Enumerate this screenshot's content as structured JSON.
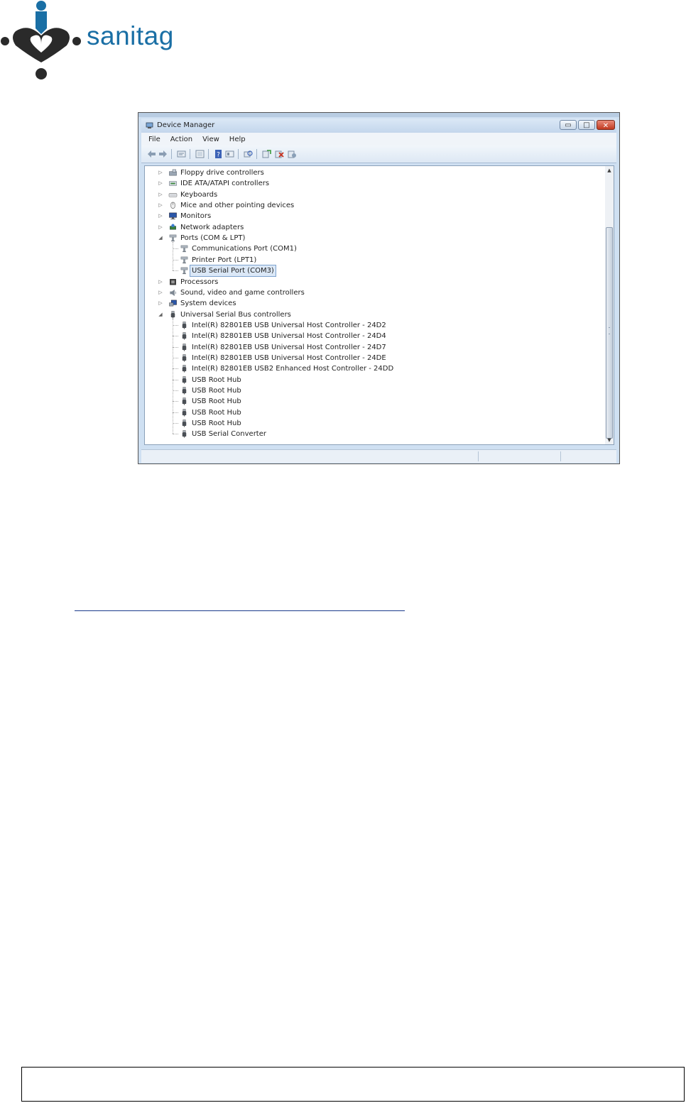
{
  "brand": {
    "name": "sanitag",
    "color": "#1a6fa5"
  },
  "window": {
    "title": "Device Manager",
    "menu": [
      "File",
      "Action",
      "View",
      "Help"
    ],
    "controls": {
      "minimize": "▭",
      "maximize": "□",
      "close": "✕"
    }
  },
  "tree": {
    "items": [
      {
        "label": "Floppy drive controllers",
        "level": 0,
        "expander": "▷",
        "icon": "floppy-controller-icon"
      },
      {
        "label": "IDE ATA/ATAPI controllers",
        "level": 0,
        "expander": "▷",
        "icon": "ide-controller-icon"
      },
      {
        "label": "Keyboards",
        "level": 0,
        "expander": "▷",
        "icon": "keyboard-icon"
      },
      {
        "label": "Mice and other pointing devices",
        "level": 0,
        "expander": "▷",
        "icon": "mouse-icon"
      },
      {
        "label": "Monitors",
        "level": 0,
        "expander": "▷",
        "icon": "monitor-icon"
      },
      {
        "label": "Network adapters",
        "level": 0,
        "expander": "▷",
        "icon": "network-adapter-icon"
      },
      {
        "label": "Ports (COM & LPT)",
        "level": 0,
        "expander": "◢",
        "icon": "port-icon"
      },
      {
        "label": "Communications Port (COM1)",
        "level": 1,
        "icon": "port-icon"
      },
      {
        "label": "Printer Port (LPT1)",
        "level": 1,
        "icon": "port-icon"
      },
      {
        "label": "USB Serial Port (COM3)",
        "level": 1,
        "icon": "port-icon",
        "selected": true
      },
      {
        "label": "Processors",
        "level": 0,
        "expander": "▷",
        "icon": "processor-icon"
      },
      {
        "label": "Sound, video and game controllers",
        "level": 0,
        "expander": "▷",
        "icon": "sound-icon"
      },
      {
        "label": "System devices",
        "level": 0,
        "expander": "▷",
        "icon": "system-devices-icon"
      },
      {
        "label": "Universal Serial Bus controllers",
        "level": 0,
        "expander": "◢",
        "icon": "usb-icon"
      },
      {
        "label": "Intel(R) 82801EB USB Universal Host Controller - 24D2",
        "level": 1,
        "icon": "usb-icon"
      },
      {
        "label": "Intel(R) 82801EB USB Universal Host Controller - 24D4",
        "level": 1,
        "icon": "usb-icon"
      },
      {
        "label": "Intel(R) 82801EB USB Universal Host Controller - 24D7",
        "level": 1,
        "icon": "usb-icon"
      },
      {
        "label": "Intel(R) 82801EB USB Universal Host Controller - 24DE",
        "level": 1,
        "icon": "usb-icon"
      },
      {
        "label": "Intel(R) 82801EB USB2 Enhanced Host Controller - 24DD",
        "level": 1,
        "icon": "usb-icon"
      },
      {
        "label": "USB Root Hub",
        "level": 1,
        "icon": "usb-icon"
      },
      {
        "label": "USB Root Hub",
        "level": 1,
        "icon": "usb-icon"
      },
      {
        "label": "USB Root Hub",
        "level": 1,
        "icon": "usb-icon"
      },
      {
        "label": "USB Root Hub",
        "level": 1,
        "icon": "usb-icon"
      },
      {
        "label": "USB Root Hub",
        "level": 1,
        "icon": "usb-icon"
      },
      {
        "label": "USB Serial Converter",
        "level": 1,
        "icon": "usb-icon"
      }
    ]
  },
  "scrollbar": {
    "up": "▲",
    "down": "▼"
  }
}
